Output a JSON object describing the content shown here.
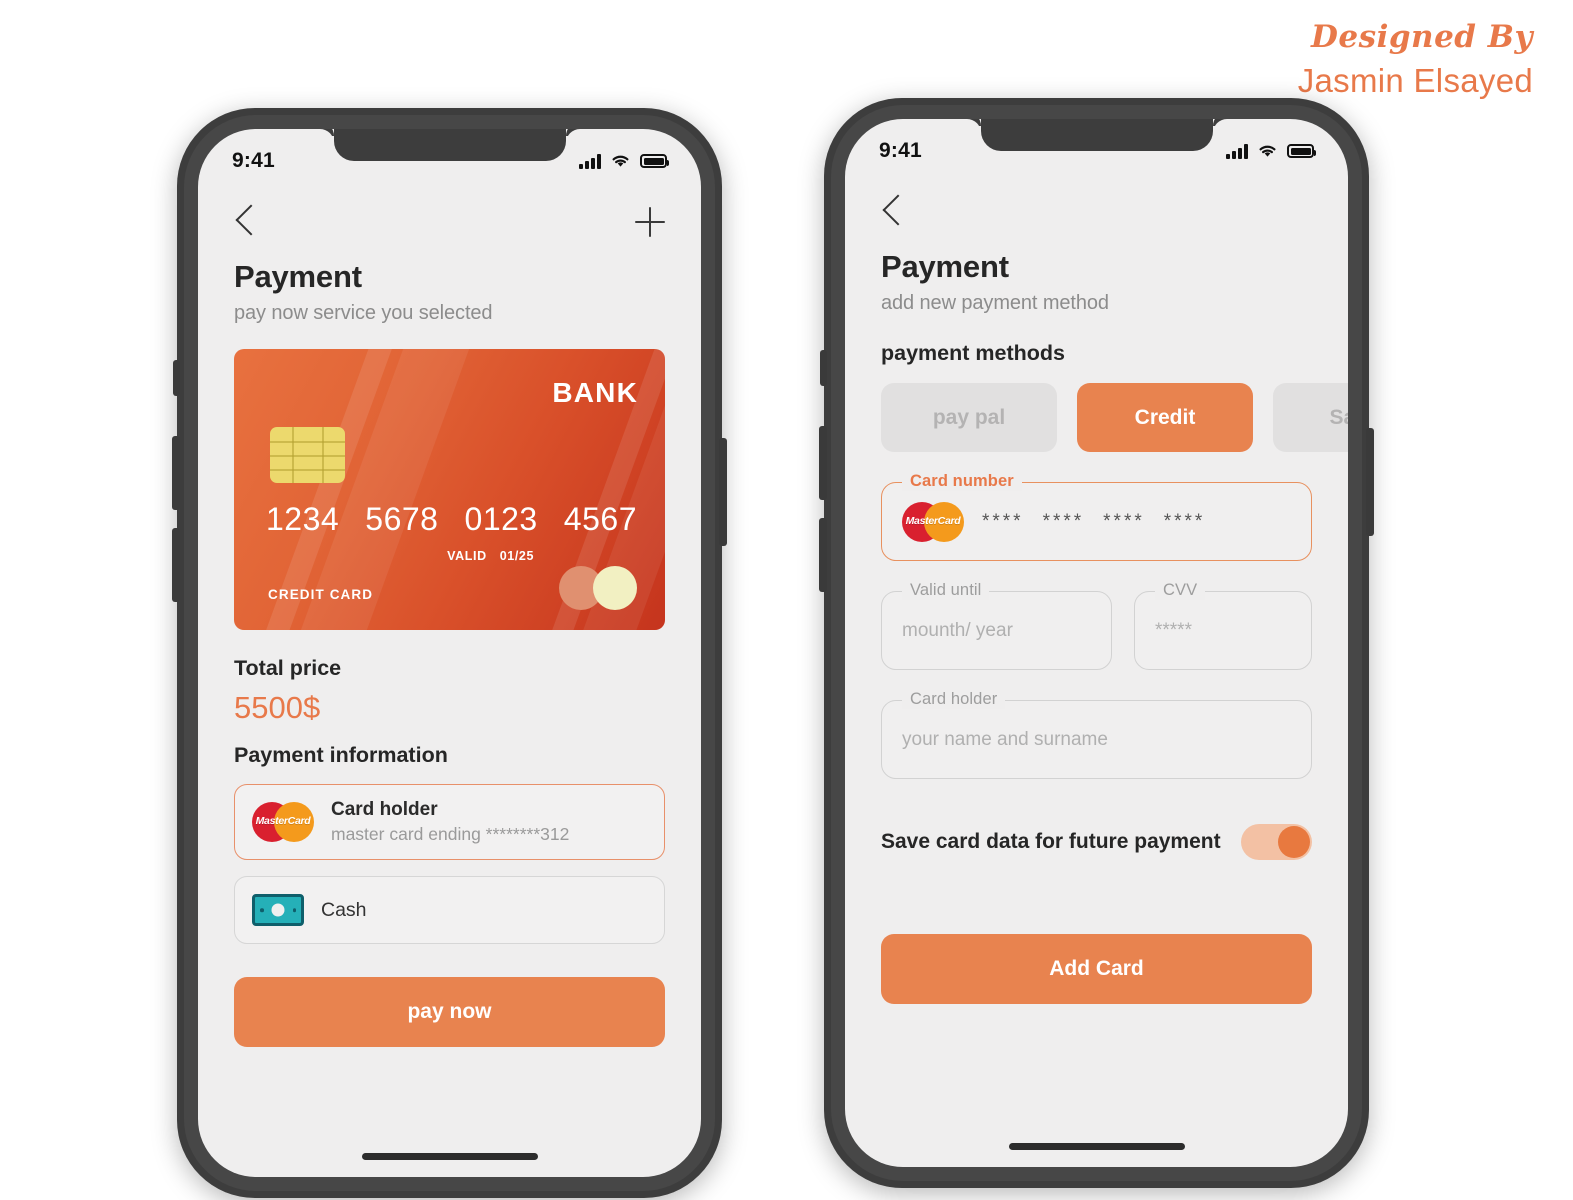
{
  "credit": {
    "line1": "Designed By",
    "line2": "Jasmin Elsayed"
  },
  "colors": {
    "accent": "#e8834f",
    "accent_text": "#e8794a",
    "screen_bg": "#efeeee",
    "frame": "#3d3d3d"
  },
  "phone_left": {
    "status": {
      "time": "9:41",
      "signal_icon": "signal-bars-icon",
      "wifi_icon": "wifi-icon",
      "battery_icon": "battery-full-icon"
    },
    "nav": {
      "back_icon": "chevron-left-icon",
      "add_icon": "plus-icon"
    },
    "title": "Payment",
    "subtitle": "pay now service you selected",
    "card": {
      "bank": "BANK",
      "number_groups": [
        "1234",
        "5678",
        "0123",
        "4567"
      ],
      "valid_label": "VALID",
      "valid_value": "01/25",
      "type": "CREDIT CARD",
      "chip_icon": "card-chip-icon",
      "brand_icon": "mastercard-circles-icon"
    },
    "total_label": "Total price",
    "total_amount": "5500$",
    "payinfo_label": "Payment information",
    "methods": [
      {
        "icon": "mastercard-logo-icon",
        "icon_text": "MasterCard",
        "title": "Card holder",
        "subtitle": "master card ending ********312",
        "selected": true
      },
      {
        "icon": "cash-banknote-icon",
        "title": "Cash",
        "selected": false
      }
    ],
    "cta_label": "pay now"
  },
  "phone_right": {
    "status": {
      "time": "9:41",
      "signal_icon": "signal-bars-icon",
      "wifi_icon": "wifi-icon",
      "battery_icon": "battery-full-icon"
    },
    "nav": {
      "back_icon": "chevron-left-icon"
    },
    "title": "Payment",
    "subtitle": "add new payment method",
    "methods_label": "payment methods",
    "method_tabs": [
      {
        "label": "pay pal",
        "selected": false
      },
      {
        "label": "Credit",
        "selected": true
      },
      {
        "label": "Sadad",
        "selected": false
      }
    ],
    "fields": {
      "card_number": {
        "label": "Card number",
        "icon": "mastercard-logo-icon",
        "icon_text": "MasterCard",
        "value_groups": [
          "****",
          "****",
          "****",
          "****"
        ]
      },
      "valid_until": {
        "label": "Valid until",
        "placeholder": "mounth/ year"
      },
      "cvv": {
        "label": "CVV",
        "value": "*****"
      },
      "card_holder": {
        "label": "Card holder",
        "placeholder": "your name and surname"
      }
    },
    "save_label": "Save card data for future payment",
    "save_toggle_on": true,
    "cta_label": "Add Card"
  }
}
